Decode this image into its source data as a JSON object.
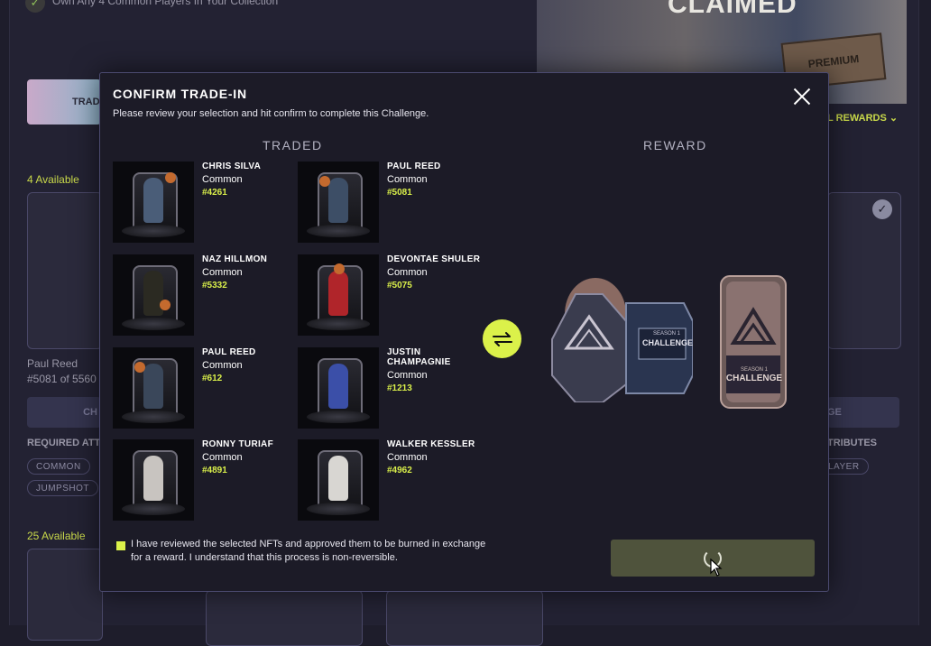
{
  "background": {
    "requirement_text": "Own Any 4 Common Players In Your Collection",
    "hero_title": "CLAIMED",
    "hero_badge": "PREMIUM",
    "trade_button": "TRAD",
    "all_rewards_label": "L REWARDS",
    "available_top": "4 Available",
    "available_bottom": "25 Available",
    "player_name": "Paul Reed",
    "player_number": "#5081 of 5560",
    "left_button": "CH",
    "right_button": "GE",
    "required_left": "REQUIRED ATT",
    "required_right": "TRIBUTES",
    "chips": [
      "COMMON",
      "JUMPSHOT",
      "LAYER"
    ]
  },
  "modal": {
    "title": "CONFIRM TRADE-IN",
    "subtitle": "Please review your selection and hit confirm to complete this Challenge.",
    "traded_header": "TRADED",
    "reward_header": "REWARD",
    "traded": [
      {
        "name": "CHRIS SILVA",
        "rarity": "Common",
        "serial": "#4261"
      },
      {
        "name": "PAUL REED",
        "rarity": "Common",
        "serial": "#5081"
      },
      {
        "name": "NAZ HILLMON",
        "rarity": "Common",
        "serial": "#5332"
      },
      {
        "name": "DEVONTAE SHULER",
        "rarity": "Common",
        "serial": "#5075"
      },
      {
        "name": "PAUL REED",
        "rarity": "Common",
        "serial": "#612"
      },
      {
        "name": "JUSTIN CHAMPAGNIE",
        "rarity": "Common",
        "serial": "#1213"
      },
      {
        "name": "RONNY TURIAF",
        "rarity": "Common",
        "serial": "#4891"
      },
      {
        "name": "WALKER KESSLER",
        "rarity": "Common",
        "serial": "#4962"
      }
    ],
    "reward": {
      "pack_label_top": "SEASON 1",
      "pack_label": "CHALLENGE",
      "card_label_top": "SEASON 1",
      "card_label": "CHALLENGE"
    },
    "consent_text": "I have reviewed the selected NFTs and approved them to be burned in exchange for a reward. I understand that this process is non-reversible.",
    "confirm_state": "loading"
  },
  "colors": {
    "accent": "#dbf14a",
    "modal_bg": "#1c1b27",
    "page_bg": "#1e1d2b",
    "confirm_bg": "#4f533c"
  }
}
